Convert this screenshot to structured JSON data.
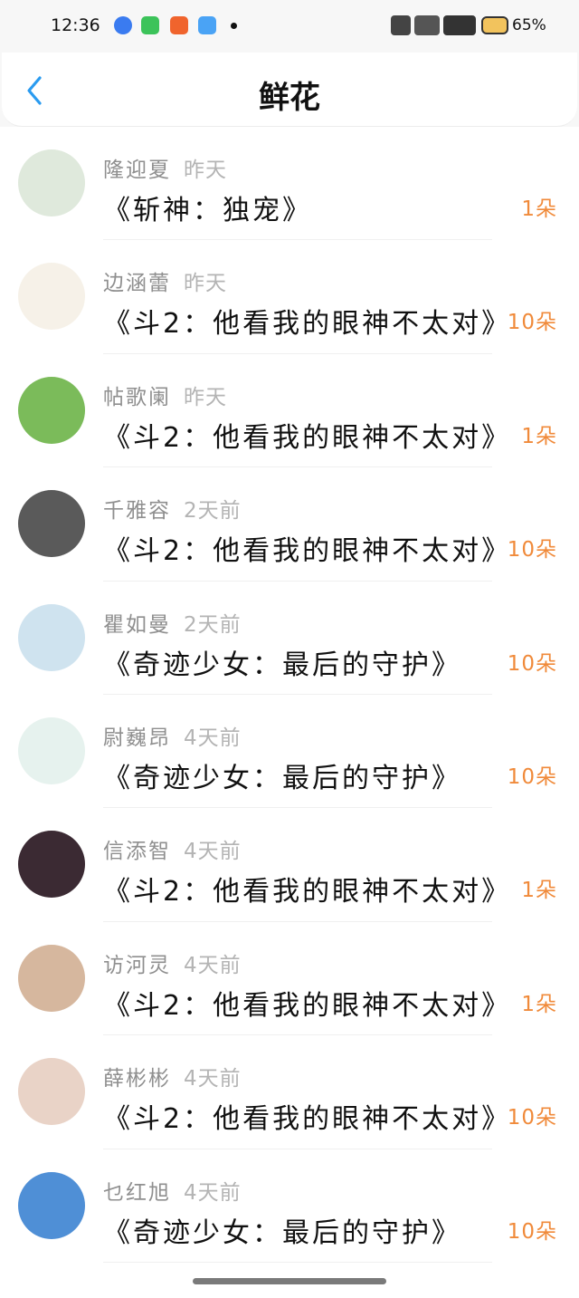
{
  "status_bar": {
    "time": "12:36",
    "battery": "65%",
    "app_icons": [
      {
        "name": "browser-app-icon",
        "color": "#3a7bf0"
      },
      {
        "name": "grid-app-icon",
        "color": "#3cc35a"
      },
      {
        "name": "s-app-icon",
        "color": "#f0642d"
      },
      {
        "name": "weather-app-icon",
        "color": "#4aa3f5"
      }
    ]
  },
  "header": {
    "title": "鲜花",
    "back_icon": "chevron-left-icon",
    "accent_color": "#2a9bf0"
  },
  "colors": {
    "count": "#f08a3a",
    "name": "#8f8f8f",
    "time": "#b4b4b4"
  },
  "records": [
    {
      "name": "隆迎夏",
      "time": "昨天",
      "book": "《斩神：独宠》",
      "count": "1朵",
      "avatar_color": "#dfe9dc",
      "avatar_icon": "girl-sitting-avatar"
    },
    {
      "name": "边涵蕾",
      "time": "昨天",
      "book": "《斗2：他看我的眼神不太对》",
      "count": "10朵",
      "avatar_color": "#f6f1e8",
      "avatar_icon": "cartoon-boys-avatar"
    },
    {
      "name": "帖歌阑",
      "time": "昨天",
      "book": "《斗2：他看我的眼神不太对》",
      "count": "1朵",
      "avatar_color": "#7bbb5a",
      "avatar_icon": "berries-avatar"
    },
    {
      "name": "千雅容",
      "time": "2天前",
      "book": "《斗2：他看我的眼神不太对》",
      "count": "10朵",
      "avatar_color": "#5a5a5a",
      "avatar_icon": "couple-avatar"
    },
    {
      "name": "瞿如曼",
      "time": "2天前",
      "book": "《奇迹少女：最后的守护》",
      "count": "10朵",
      "avatar_color": "#cfe3ef",
      "avatar_icon": "anime-girl-avatar"
    },
    {
      "name": "尉巍昂",
      "time": "4天前",
      "book": "《奇迹少女：最后的守护》",
      "count": "10朵",
      "avatar_color": "#e6f2ee",
      "avatar_icon": "anime-girl-teal-avatar"
    },
    {
      "name": "信添智",
      "time": "4天前",
      "book": "《斗2：他看我的眼神不太对》",
      "count": "1朵",
      "avatar_color": "#3b2a33",
      "avatar_icon": "anime-boy-avatar"
    },
    {
      "name": "访河灵",
      "time": "4天前",
      "book": "《斗2：他看我的眼神不太对》",
      "count": "1朵",
      "avatar_color": "#d6b79e",
      "avatar_icon": "child-face-avatar"
    },
    {
      "name": "薛彬彬",
      "time": "4天前",
      "book": "《斗2：他看我的眼神不太对》",
      "count": "10朵",
      "avatar_color": "#e9d3c7",
      "avatar_icon": "woman-portrait-avatar"
    },
    {
      "name": "乜红旭",
      "time": "4天前",
      "book": "《奇迹少女：最后的守护》",
      "count": "10朵",
      "avatar_color": "#4f8fd6",
      "avatar_icon": "sky-text-avatar"
    }
  ]
}
